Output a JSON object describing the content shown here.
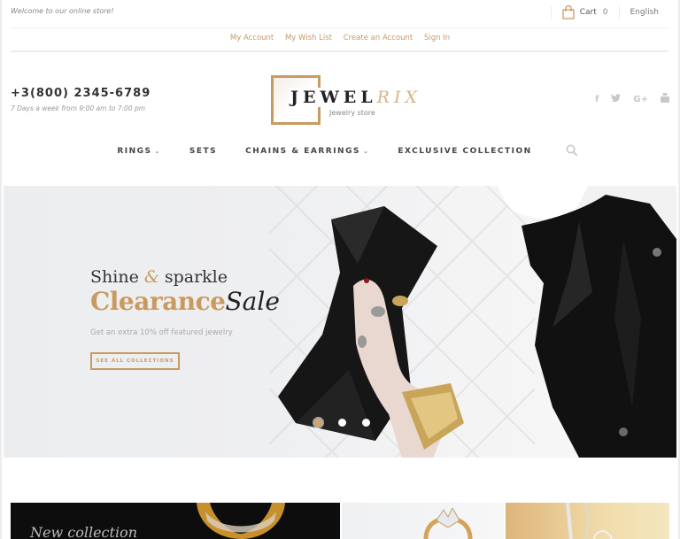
{
  "topbar": {
    "welcome": "Welcome to our online store!",
    "cart_label": "Cart",
    "cart_count": "0",
    "language": "English"
  },
  "account_links": [
    "My Account",
    "My Wish List",
    "Create an Account",
    "Sign In"
  ],
  "header": {
    "phone": "+3(800) 2345-6789",
    "hours": "7 Days a week from 9:00 am to 7:00 pm",
    "logo_main": "JEWEL",
    "logo_accent": "RIX",
    "logo_tagline": "Jewelry store",
    "social": [
      {
        "icon": "facebook-icon",
        "glyph": "f"
      },
      {
        "icon": "twitter-icon",
        "glyph": "t"
      },
      {
        "icon": "google-plus-icon",
        "glyph": "G+"
      },
      {
        "icon": "youtube-icon",
        "glyph": "▲"
      }
    ]
  },
  "nav": {
    "items": [
      {
        "label": "RINGS",
        "has_dropdown": true
      },
      {
        "label": "SETS",
        "has_dropdown": false
      },
      {
        "label": "CHAINS & EARRINGS",
        "has_dropdown": true
      },
      {
        "label": "EXCLUSIVE COLLECTION",
        "has_dropdown": false
      }
    ],
    "chevron": "⌄"
  },
  "hero": {
    "title_part1": "Shine",
    "title_amp": "&",
    "title_part2": "sparkle",
    "headline_accent": "Clearance",
    "headline_rest": "Sale",
    "subtitle": "Get an extra 10% off featured jewelry",
    "button_label": "SEE ALL COLLECTIONS",
    "slides_total": 3,
    "active_slide": 1
  },
  "banners": [
    {
      "text": "New collection"
    },
    {
      "text": ""
    },
    {
      "text": ""
    }
  ],
  "colors": {
    "accent": "#c99a60",
    "text_dark": "#333333",
    "muted": "#999999"
  }
}
